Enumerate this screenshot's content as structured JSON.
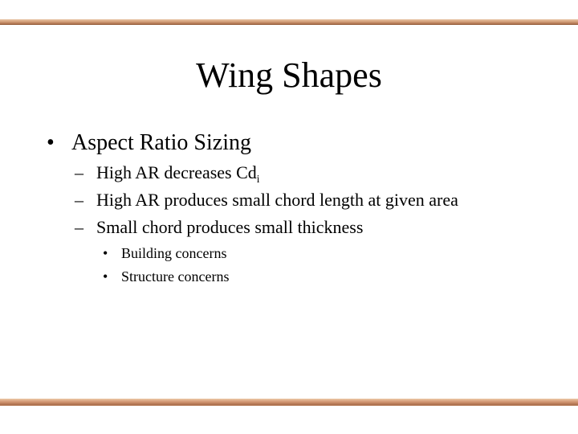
{
  "slide": {
    "title": "Wing Shapes",
    "bullets": [
      {
        "marker": "•",
        "text": "Aspect Ratio Sizing",
        "children": [
          {
            "marker": "–",
            "text": "High AR decreases Cd",
            "subscript": "i"
          },
          {
            "marker": "–",
            "text": "High AR produces small chord length at given area"
          },
          {
            "marker": "–",
            "text": "Small chord produces small thickness",
            "children": [
              {
                "marker": "•",
                "text": "Building concerns"
              },
              {
                "marker": "•",
                "text": "Structure concerns"
              }
            ]
          }
        ]
      }
    ]
  },
  "colors": {
    "accent_bar": "#c0825e",
    "text": "#000000",
    "background": "#ffffff"
  }
}
